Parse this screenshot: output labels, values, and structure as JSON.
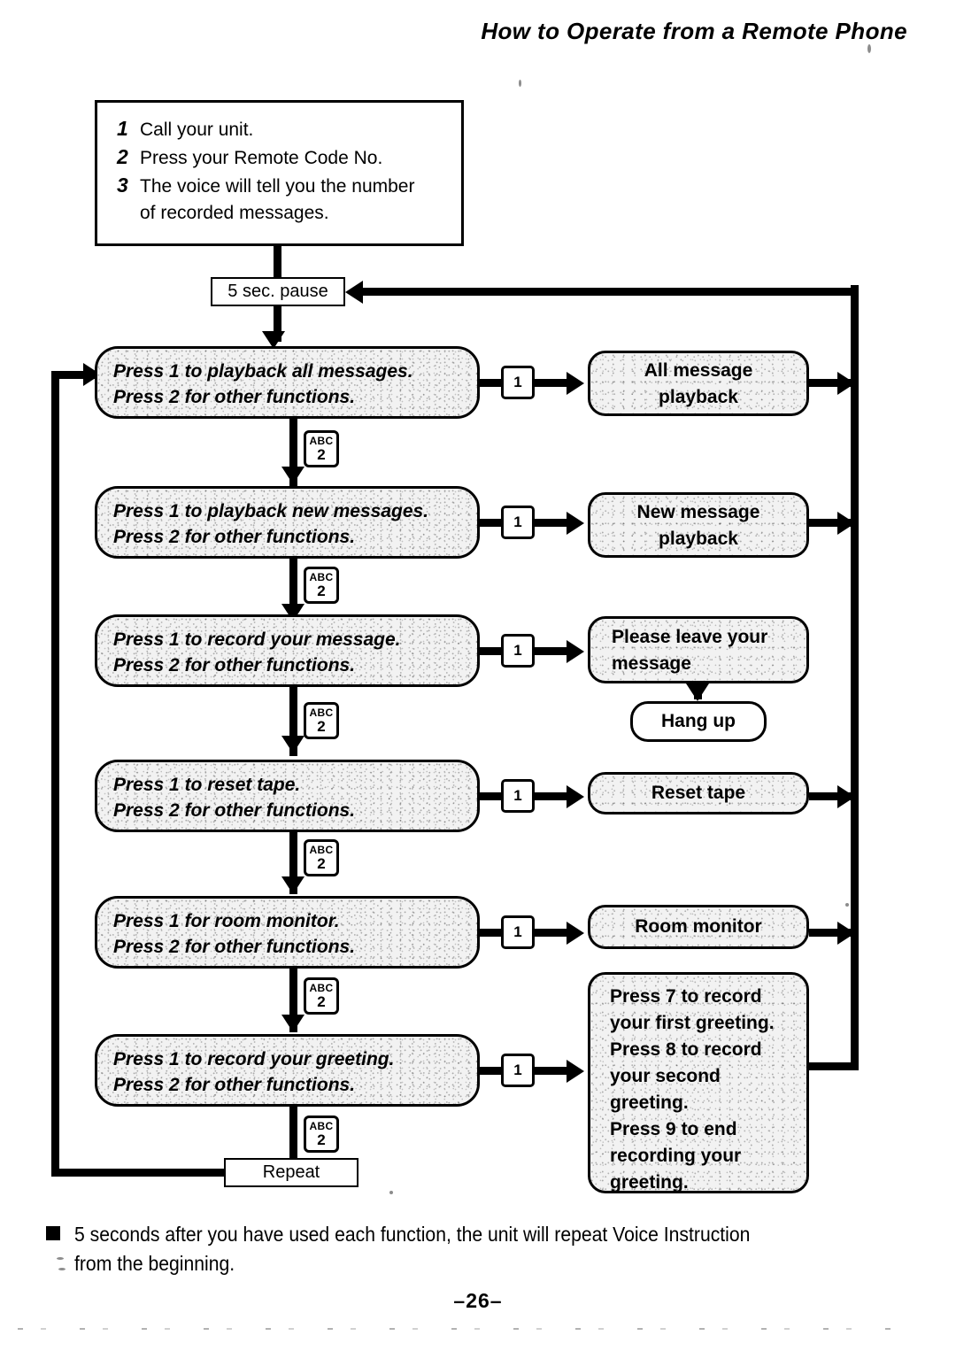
{
  "header": {
    "title": "How to Operate from a Remote Phone"
  },
  "intro": {
    "steps": [
      {
        "num": "1",
        "text": "Call your unit."
      },
      {
        "num": "2",
        "text": "Press your Remote Code No."
      },
      {
        "num": "3",
        "text": "The voice will tell you the number",
        "cont": "of recorded messages."
      }
    ]
  },
  "nodes": {
    "pause": "5 sec. pause",
    "repeat": "Repeat",
    "hang_up": "Hang up"
  },
  "keys": {
    "one": "1",
    "two_alpha": "ABC",
    "two_digit": "2"
  },
  "prompts": [
    {
      "line1": "Press 1 to playback all messages.",
      "line2": "Press 2 for other functions."
    },
    {
      "line1": "Press 1 to playback new messages.",
      "line2": "Press 2 for other functions."
    },
    {
      "line1": "Press 1 to record your message.",
      "line2": "Press 2 for other functions."
    },
    {
      "line1": "Press 1 to reset tape.",
      "line2": "Press 2 for other functions."
    },
    {
      "line1": "Press 1 for room monitor.",
      "line2": "Press 2 for other functions."
    },
    {
      "line1": "Press 1 to record your greeting.",
      "line2": "Press 2 for other functions."
    }
  ],
  "results": [
    {
      "line1": "All message",
      "line2": "playback"
    },
    {
      "line1": "New message",
      "line2": "playback"
    },
    {
      "line1": "Please leave your",
      "line2": "message"
    },
    {
      "line1": "Reset tape",
      "line2": ""
    },
    {
      "line1": "Room monitor",
      "line2": ""
    }
  ],
  "greeting_result": {
    "lines": [
      "Press 7 to record",
      "your first greeting.",
      "Press 8 to record",
      "your second",
      "greeting.",
      "Press 9 to end",
      "recording your",
      "greeting."
    ]
  },
  "footer": {
    "note_line1": "5 seconds after you have used each function, the unit will repeat Voice Instruction",
    "note_line2": "from the beginning.",
    "page_number": "–26–"
  },
  "colors": {
    "ink": "#000000",
    "paper": "#ffffff",
    "box_fill": "#f2f2f2"
  }
}
